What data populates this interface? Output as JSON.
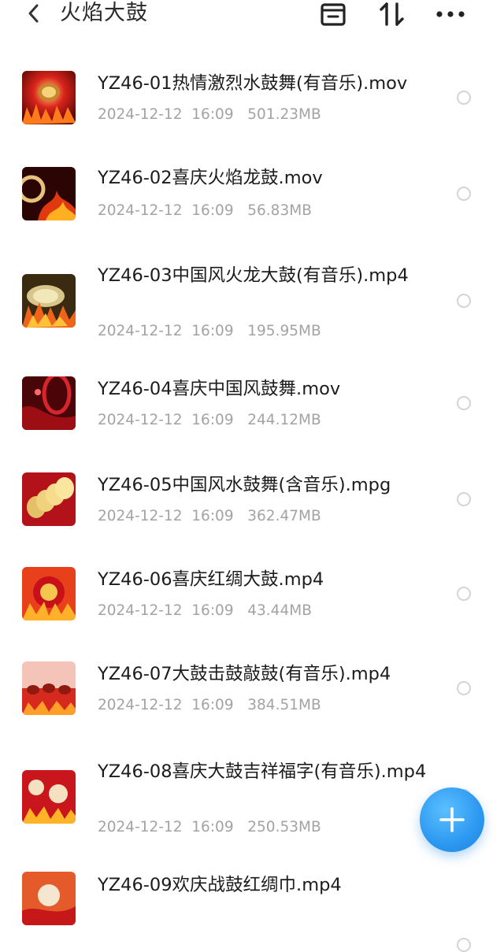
{
  "header": {
    "title": "火焰大鼓",
    "back_icon": "chevron-left-icon",
    "actions": [
      "select-all-icon",
      "sort-icon",
      "more-icon"
    ]
  },
  "files": [
    {
      "name": "YZ46-01热情激烈水鼓舞(有音乐).mov",
      "date": "2024-12-12",
      "time": "16:09",
      "size": "501.23MB",
      "selected": false
    },
    {
      "name": "YZ46-02喜庆火焰龙鼓.mov",
      "date": "2024-12-12",
      "time": "16:09",
      "size": "56.83MB",
      "selected": false
    },
    {
      "name": "YZ46-03中国风火龙大鼓(有音乐).mp4",
      "date": "2024-12-12",
      "time": "16:09",
      "size": "195.95MB",
      "selected": false
    },
    {
      "name": "YZ46-04喜庆中国风鼓舞.mov",
      "date": "2024-12-12",
      "time": "16:09",
      "size": "244.12MB",
      "selected": false
    },
    {
      "name": "YZ46-05中国风水鼓舞(含音乐).mpg",
      "date": "2024-12-12",
      "time": "16:09",
      "size": "362.47MB",
      "selected": false
    },
    {
      "name": "YZ46-06喜庆红绸大鼓.mp4",
      "date": "2024-12-12",
      "time": "16:09",
      "size": "43.44MB",
      "selected": false
    },
    {
      "name": "YZ46-07大鼓击鼓敲鼓(有音乐).mp4",
      "date": "2024-12-12",
      "time": "16:09",
      "size": "384.51MB",
      "selected": false
    },
    {
      "name": "YZ46-08喜庆大鼓吉祥福字(有音乐).mp4",
      "date": "2024-12-12",
      "time": "16:09",
      "size": "250.53MB",
      "selected": false
    },
    {
      "name": "YZ46-09欢庆战鼓红绸巾.mp4",
      "date": "",
      "time": "",
      "size": "",
      "selected": false
    }
  ],
  "fab": {
    "icon": "plus-icon"
  },
  "colors": {
    "accent": "#2c98f0",
    "meta_text": "#a3a3a3",
    "title_text": "#1c1c1c"
  }
}
